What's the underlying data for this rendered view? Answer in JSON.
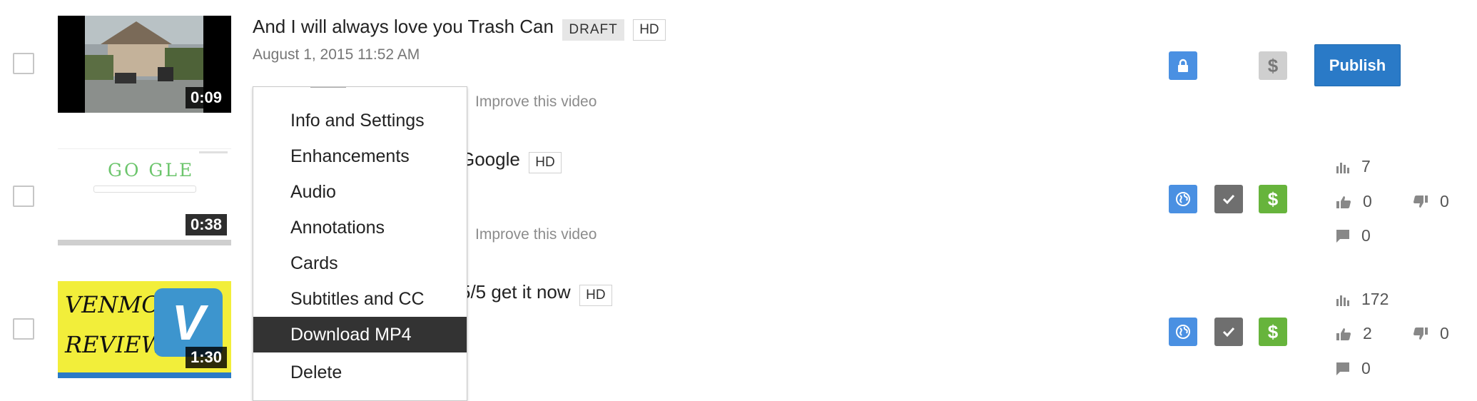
{
  "colors": {
    "accent_blue": "#4a90e2",
    "publish_blue": "#2a7ac7",
    "monetize_green": "#67b43c",
    "menu_active": "#333333"
  },
  "videos": [
    {
      "title": "And I will always love you Trash Can",
      "badges": [
        "DRAFT",
        "HD"
      ],
      "date": "August 1, 2015 11:52 AM",
      "improve": "Improve this video",
      "duration": "0:09",
      "visibility_icon": "lock-icon",
      "monetize_icon": "dollar-icon",
      "publish_label": "Publish"
    },
    {
      "title_visible": "Google",
      "badges": [
        "HD"
      ],
      "improve": "Improve this video",
      "duration": "0:38",
      "thumb_text": "GO GLE",
      "visibility_icon": "globe-icon",
      "check_icon": "check-icon",
      "monetize_icon": "dollar-icon",
      "views": "7",
      "likes": "0",
      "dislikes": "0",
      "comments": "0"
    },
    {
      "title_visible": "5/5 get it now",
      "badges": [
        "HD"
      ],
      "duration": "1:30",
      "thumb_text_1": "VENMO",
      "thumb_text_2": "REVIEW",
      "thumb_logo": "V",
      "visibility_icon": "globe-icon",
      "check_icon": "check-icon",
      "monetize_icon": "dollar-icon",
      "views": "172",
      "likes": "2",
      "dislikes": "0",
      "comments": "0"
    }
  ],
  "menu": {
    "items": [
      "Info and Settings",
      "Enhancements",
      "Audio",
      "Annotations",
      "Cards",
      "Subtitles and CC",
      "Download MP4",
      "Delete"
    ],
    "active_index": 6
  }
}
